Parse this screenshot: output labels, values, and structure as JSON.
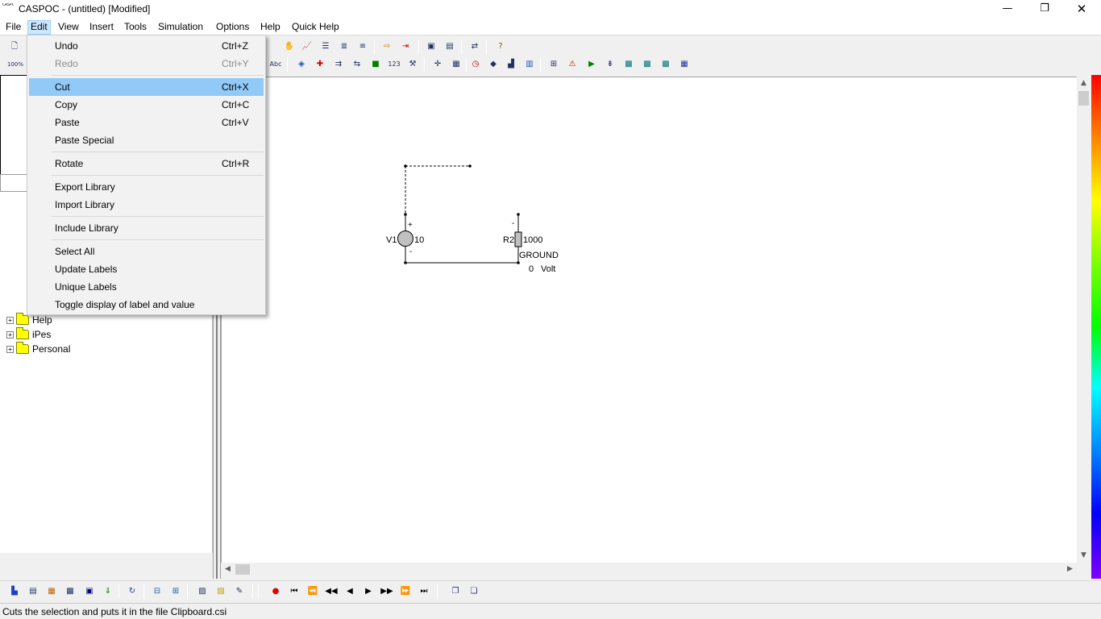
{
  "window": {
    "title": "CASPOC - (untitled) [Modified]",
    "icon_text": "CASPOC",
    "minimize_glyph": "—",
    "maximize_glyph": "❐",
    "close_glyph": "✕"
  },
  "menubar": [
    {
      "label": "File"
    },
    {
      "label": "Edit"
    },
    {
      "label": "View"
    },
    {
      "label": "Insert"
    },
    {
      "label": "Tools"
    },
    {
      "label": "Simulation"
    },
    {
      "label": "Options"
    },
    {
      "label": "Help"
    },
    {
      "label": "Quick Help"
    }
  ],
  "edit_menu": {
    "items": [
      {
        "label": "Undo",
        "shortcut": "Ctrl+Z"
      },
      {
        "label": "Redo",
        "shortcut": "Ctrl+Y"
      },
      {
        "label": "Cut",
        "shortcut": "Ctrl+X"
      },
      {
        "label": "Copy",
        "shortcut": "Ctrl+C"
      },
      {
        "label": "Paste",
        "shortcut": "Ctrl+V"
      },
      {
        "label": "Paste Special",
        "shortcut": ""
      },
      {
        "label": "Rotate",
        "shortcut": "Ctrl+R"
      },
      {
        "label": "Export Library",
        "shortcut": ""
      },
      {
        "label": "Import Library",
        "shortcut": ""
      },
      {
        "label": "Include Library",
        "shortcut": ""
      },
      {
        "label": "Select All",
        "shortcut": ""
      },
      {
        "label": "Update Labels",
        "shortcut": ""
      },
      {
        "label": "Unique Labels",
        "shortcut": ""
      },
      {
        "label": "Toggle display of label and value",
        "shortcut": ""
      }
    ]
  },
  "toolbar": {
    "zoom_label": "100%",
    "text_tool_label": "Abc",
    "counter_label": "123"
  },
  "tree": {
    "items": [
      {
        "label": "Help"
      },
      {
        "label": "iPes"
      },
      {
        "label": "Personal"
      }
    ]
  },
  "circuit": {
    "v1_label": "V1",
    "v1_value": "10",
    "plus_sign": "+",
    "minus_sign": "-",
    "r2_label": "R2",
    "r2_value": "1000",
    "r2_mark": "-",
    "ground_label": "GROUND",
    "node_value": "0",
    "node_unit": "Volt"
  },
  "scroll_glyphs": {
    "up": "▲",
    "down": "▼",
    "left": "◀",
    "right": "▶"
  },
  "status": {
    "text": "Cuts the selection and puts it in the file Clipboard.csi"
  },
  "colors": {
    "menu_highlight": "#91c9f7",
    "menubar_active": "#cce8ff",
    "folder": "#ffff00",
    "canvas": "#ffffff"
  }
}
